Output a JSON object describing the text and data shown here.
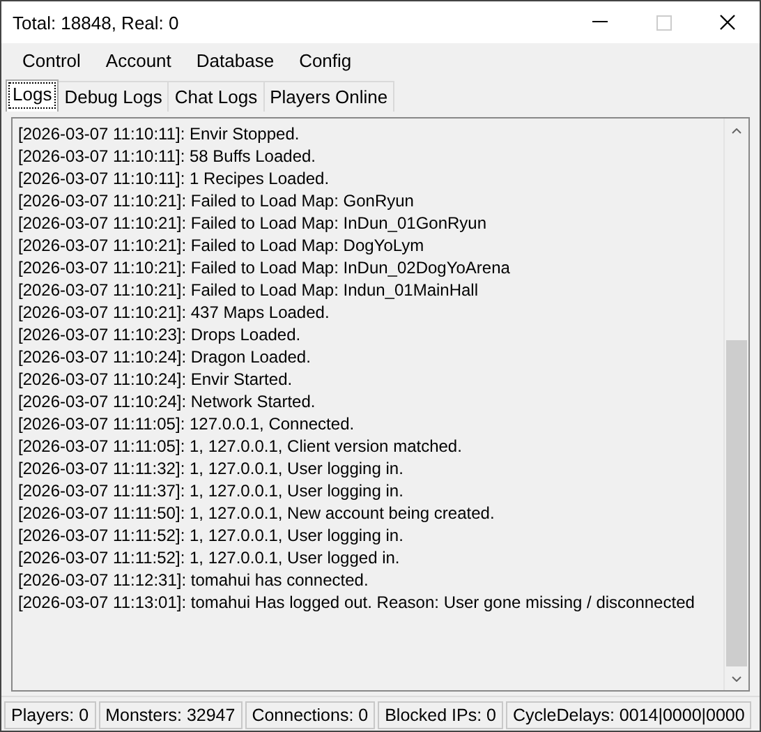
{
  "window": {
    "title": "Total: 18848, Real: 0"
  },
  "menu": [
    "Control",
    "Account",
    "Database",
    "Config"
  ],
  "tabs": [
    {
      "label": "Logs",
      "selected": true
    },
    {
      "label": "Debug Logs",
      "selected": false
    },
    {
      "label": "Chat Logs",
      "selected": false
    },
    {
      "label": "Players Online",
      "selected": false
    }
  ],
  "log_lines": [
    "[2026-03-07 11:10:11]: Envir Stopped.",
    "[2026-03-07 11:10:11]: 58 Buffs Loaded.",
    "[2026-03-07 11:10:11]: 1 Recipes Loaded.",
    "[2026-03-07 11:10:21]: Failed to Load Map: GonRyun",
    "[2026-03-07 11:10:21]: Failed to Load Map: InDun_01GonRyun",
    "[2026-03-07 11:10:21]: Failed to Load Map: DogYoLym",
    "[2026-03-07 11:10:21]: Failed to Load Map: InDun_02DogYoArena",
    "[2026-03-07 11:10:21]: Failed to Load Map: Indun_01MainHall",
    "[2026-03-07 11:10:21]: 437 Maps Loaded.",
    "[2026-03-07 11:10:23]: Drops Loaded.",
    "[2026-03-07 11:10:24]: Dragon Loaded.",
    "[2026-03-07 11:10:24]: Envir Started.",
    "[2026-03-07 11:10:24]: Network Started.",
    "[2026-03-07 11:11:05]: 127.0.0.1, Connected.",
    "[2026-03-07 11:11:05]: 1, 127.0.0.1, Client version matched.",
    "[2026-03-07 11:11:32]: 1, 127.0.0.1, User logging in.",
    "[2026-03-07 11:11:37]: 1, 127.0.0.1, User logging in.",
    "[2026-03-07 11:11:50]: 1, 127.0.0.1, New account being created.",
    "[2026-03-07 11:11:52]: 1, 127.0.0.1, User logging in.",
    "[2026-03-07 11:11:52]: 1, 127.0.0.1, User logged in.",
    "[2026-03-07 11:12:31]: tomahui has connected.",
    "[2026-03-07 11:13:01]: tomahui Has logged out. Reason: User gone missing / disconnected"
  ],
  "status_bar": [
    "Players: 0",
    "Monsters: 32947",
    "Connections: 0",
    "Blocked IPs: 0",
    "CycleDelays: 0014|0000|0000"
  ]
}
